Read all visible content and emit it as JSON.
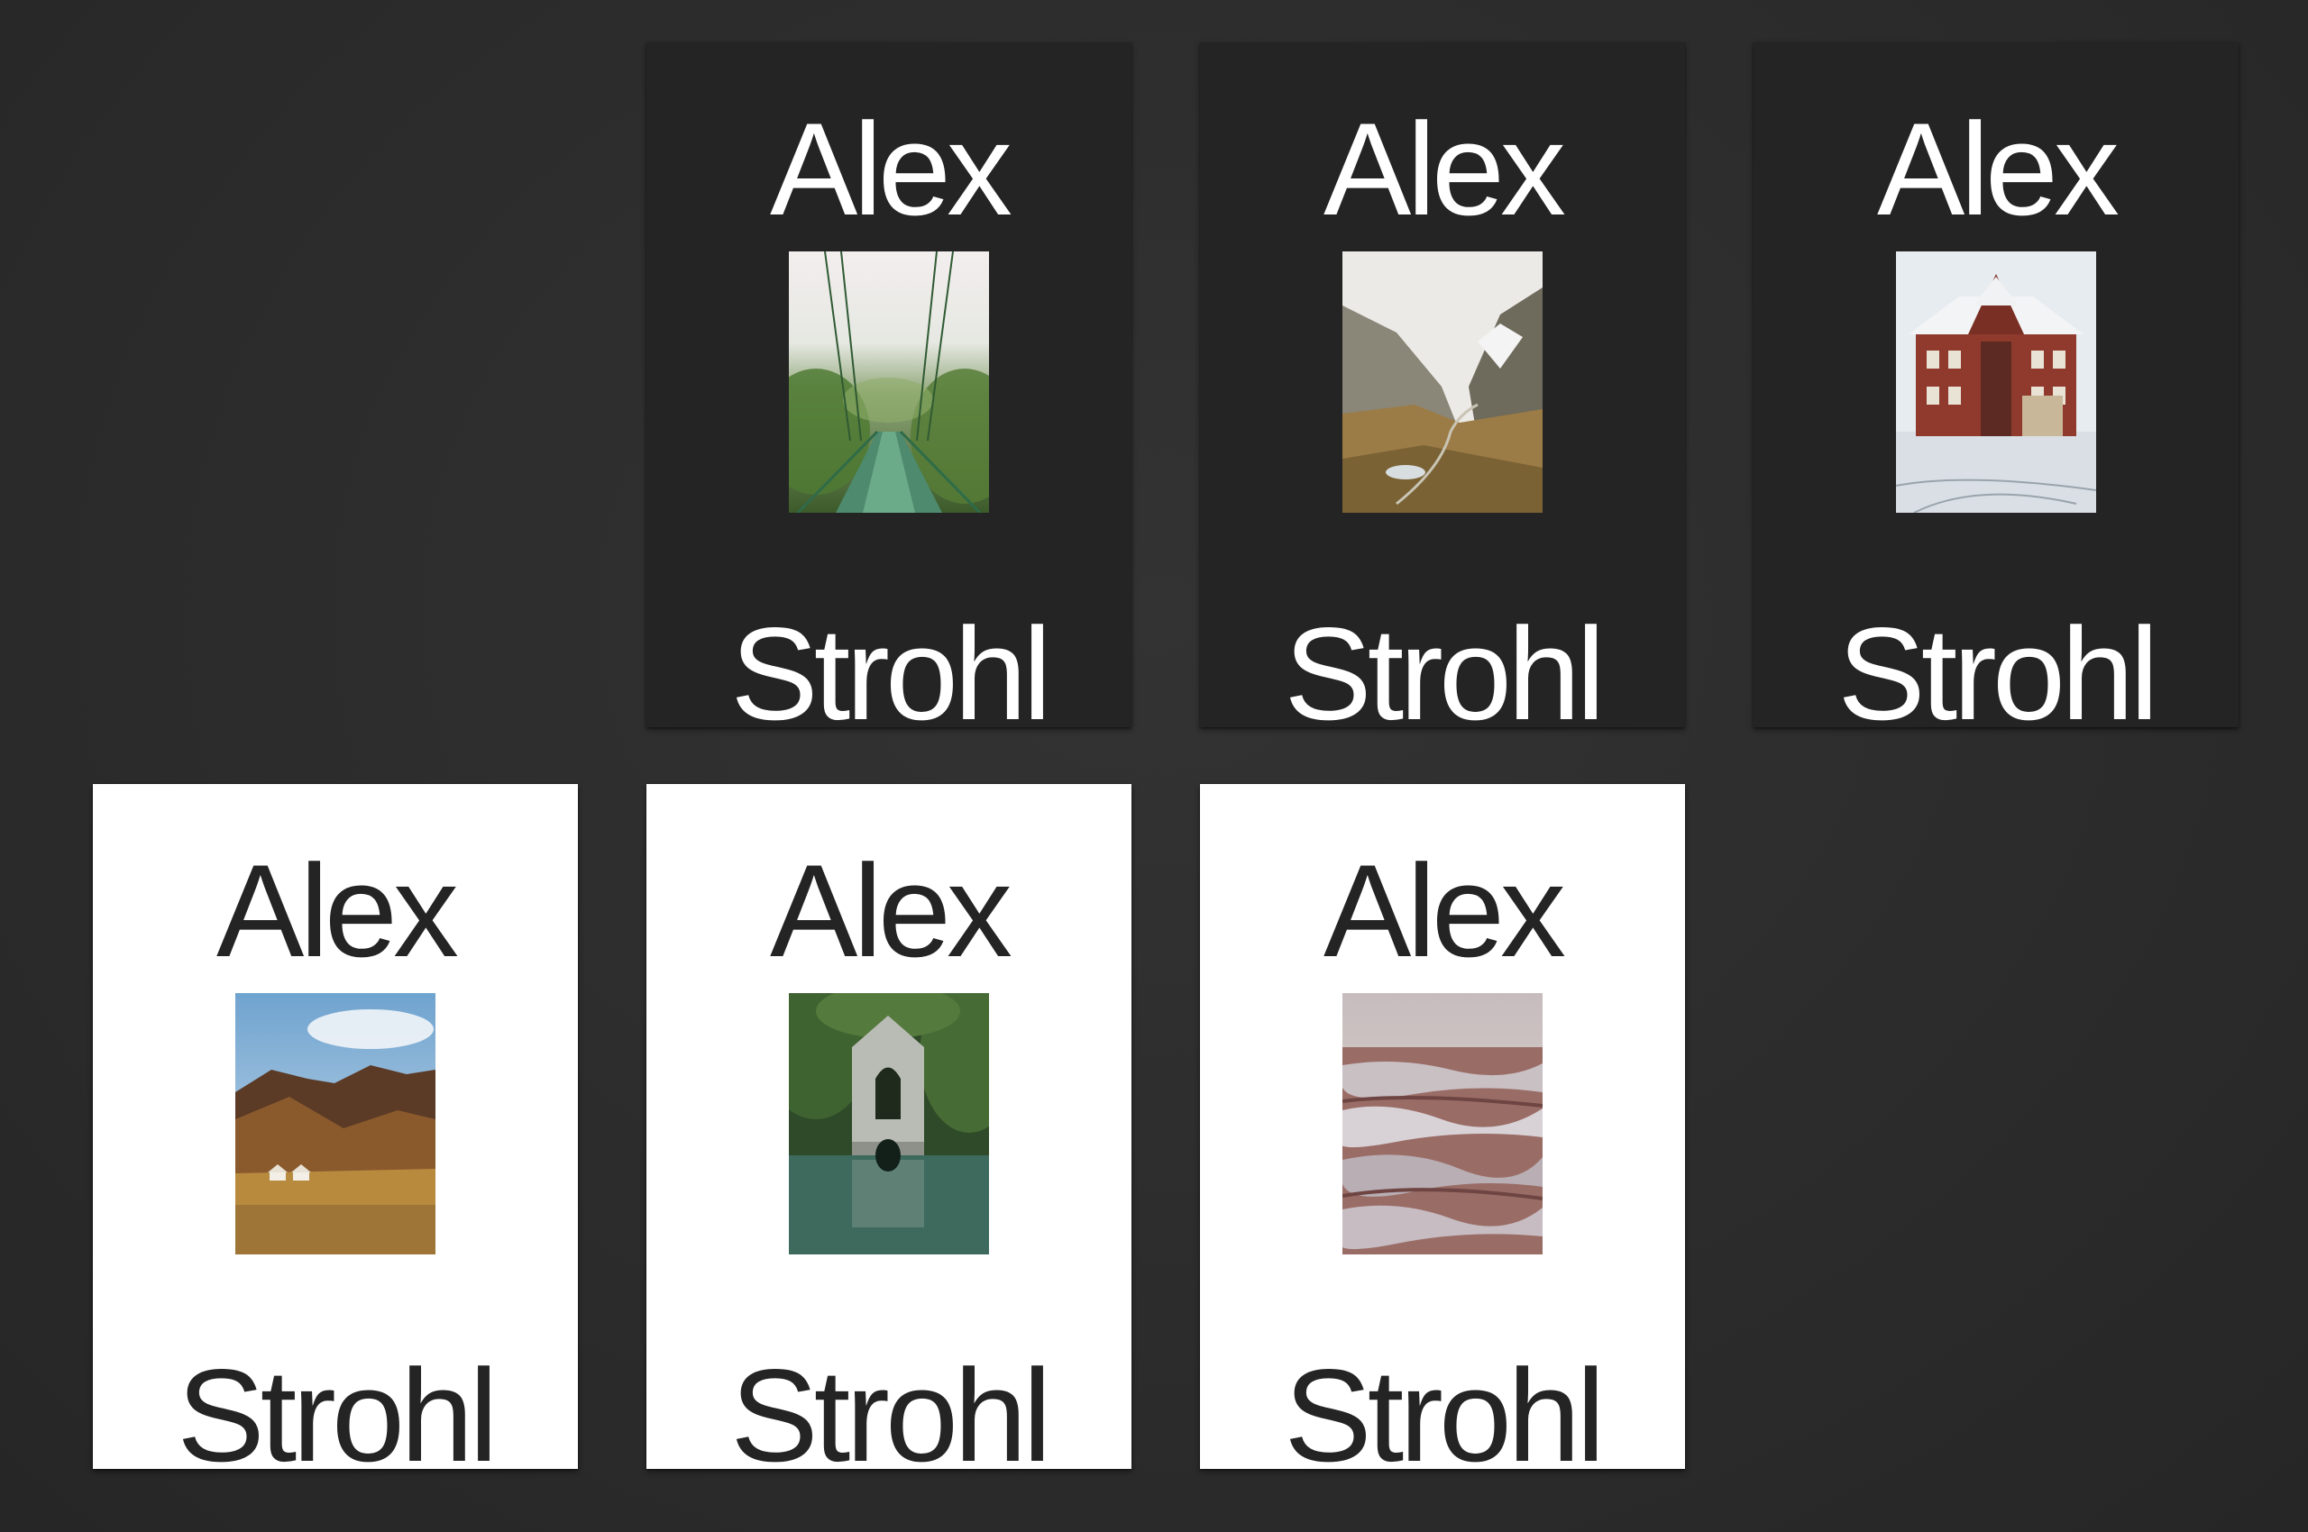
{
  "cards": [
    {
      "theme": "dark",
      "top_word": "Alex",
      "bottom_word": "Strohl",
      "photo": "suspension-bridge-forest"
    },
    {
      "theme": "dark",
      "top_word": "Alex",
      "bottom_word": "Strohl",
      "photo": "mountain-valley"
    },
    {
      "theme": "dark",
      "top_word": "Alex",
      "bottom_word": "Strohl",
      "photo": "red-house-snow"
    },
    {
      "theme": "light",
      "top_word": "Alex",
      "bottom_word": "Strohl",
      "photo": "desert-mountains-cabins"
    },
    {
      "theme": "light",
      "top_word": "Alex",
      "bottom_word": "Strohl",
      "photo": "ruined-chapel-lake"
    },
    {
      "theme": "light",
      "top_word": "Alex",
      "bottom_word": "Strohl",
      "photo": "eroded-badlands"
    }
  ],
  "colors": {
    "background": "#2b2b2b",
    "dark_card": "#242424",
    "light_card": "#ffffff"
  }
}
